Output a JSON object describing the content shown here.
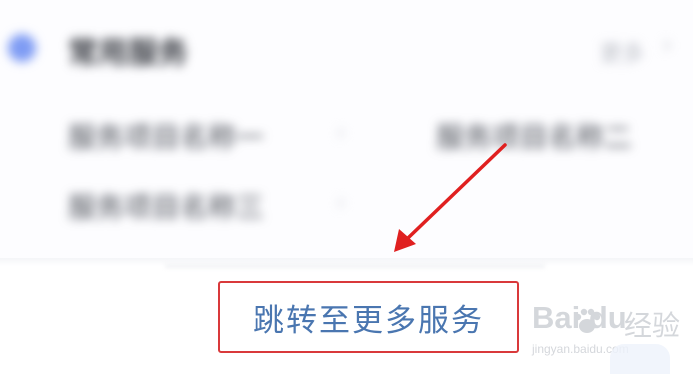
{
  "card": {
    "title": "常用服务",
    "more_label": "更多",
    "more_chevron": "›",
    "items": [
      {
        "label": "服务项目名称一"
      },
      {
        "label": "服务项目名称二"
      },
      {
        "label": "服务项目名称三"
      }
    ],
    "item_chevron": "›"
  },
  "action": {
    "jump_label": "跳转至更多服务"
  },
  "annotation": {
    "arrow_color": "#e02020"
  },
  "watermark": {
    "logo": "Bai  du",
    "jingyan": "经验",
    "url": "jingyan.baidu.com"
  },
  "colors": {
    "accent_blue": "#4a76b0",
    "highlight_red": "#d9393b",
    "dot_blue": "#7f9cf4"
  }
}
